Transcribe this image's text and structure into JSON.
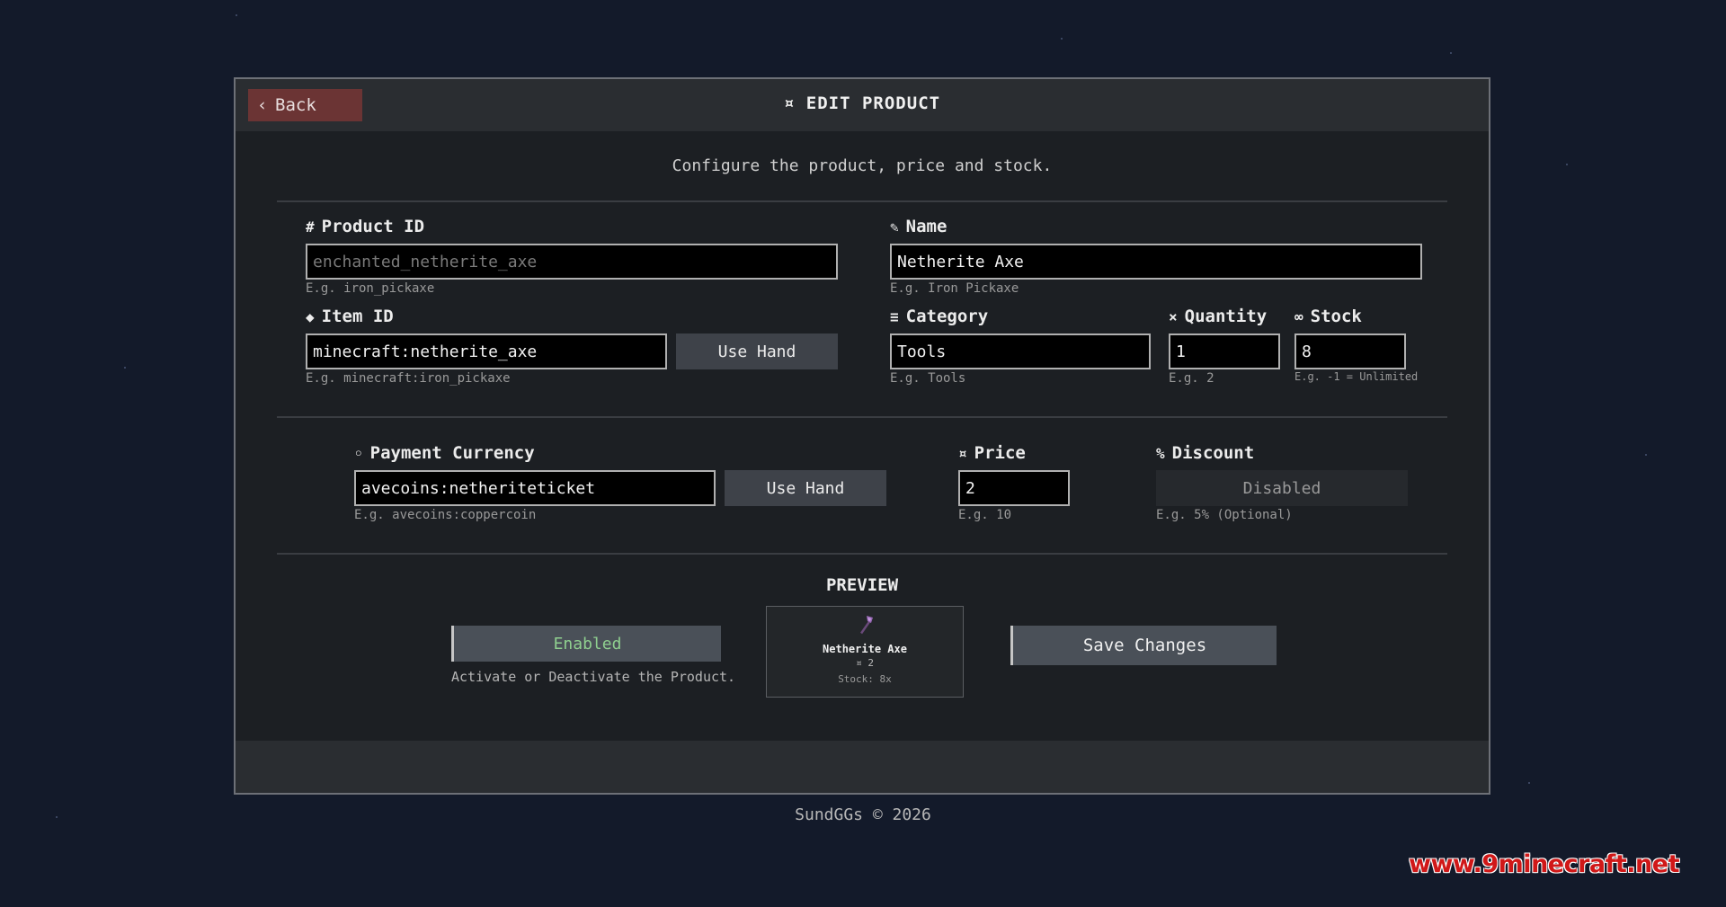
{
  "header": {
    "back_label": "Back",
    "title": "¤ EDIT PRODUCT"
  },
  "subtitle": "Configure the product, price and stock.",
  "fields": {
    "product_id": {
      "icon": "#",
      "label": "Product ID",
      "value": "enchanted_netherite_axe",
      "hint": "E.g. iron_pickaxe"
    },
    "name": {
      "icon": "✎",
      "label": "Name",
      "value": "Netherite Axe",
      "hint": "E.g. Iron Pickaxe"
    },
    "item_id": {
      "icon": "◆",
      "label": "Item ID",
      "value": "minecraft:netherite_axe",
      "hint": "E.g. minecraft:iron_pickaxe",
      "button": "Use Hand"
    },
    "category": {
      "icon": "≡",
      "label": "Category",
      "value": "Tools",
      "hint": "E.g. Tools"
    },
    "quantity": {
      "icon": "×",
      "label": "Quantity",
      "value": "1",
      "hint": "E.g. 2"
    },
    "stock": {
      "icon": "∞",
      "label": "Stock",
      "value": "8",
      "hint": "E.g. -1 = Unlimited"
    },
    "payment_currency": {
      "icon": "◦",
      "label": "Payment Currency",
      "value": "avecoins:netheriteticket",
      "hint": "E.g. avecoins:coppercoin",
      "button": "Use Hand"
    },
    "price": {
      "icon": "¤",
      "label": "Price",
      "value": "2",
      "hint": "E.g. 10"
    },
    "discount": {
      "icon": "%",
      "label": "Discount",
      "value": "Disabled",
      "hint": "E.g. 5% (Optional)"
    }
  },
  "preview": {
    "heading": "PREVIEW",
    "toggle_label": "Enabled",
    "toggle_hint": "Activate or Deactivate the Product.",
    "card_name": "Netherite Axe",
    "card_price": "2",
    "card_stock": "Stock: 8x",
    "card_icon": "netherite-axe-icon",
    "save_label": "Save Changes"
  },
  "footer": {
    "copyright": "SundGGs © 2026"
  },
  "watermark": "www.9minecraft.net",
  "colors": {
    "background": "#131a2a",
    "panel": "#1c1f23",
    "back_button": "#6b3434",
    "enabled_text": "#8fcf8f",
    "watermark": "#d01818"
  }
}
